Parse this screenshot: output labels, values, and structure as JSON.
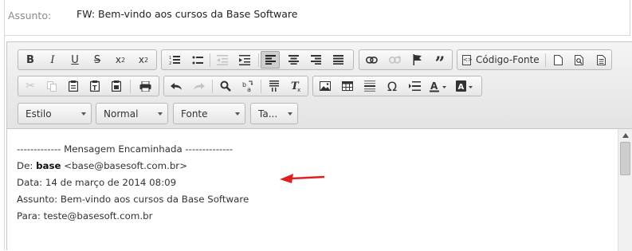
{
  "subject": {
    "label": "Assunto:",
    "value": "FW: Bem-vindo aos cursos da Base Software"
  },
  "toolbar": {
    "basicstyles": [
      {
        "name": "bold-button",
        "glyph": "B"
      },
      {
        "name": "italic-button",
        "glyph": "I"
      },
      {
        "name": "underline-button",
        "glyph": "U"
      },
      {
        "name": "strike-button",
        "glyph": "S"
      },
      {
        "name": "subscript-button",
        "glyph": "x₂"
      },
      {
        "name": "superscript-button",
        "glyph": "x²"
      }
    ],
    "source_label": "Código-Fonte",
    "style_dropdown": "Estilo",
    "format_dropdown": "Normal",
    "font_dropdown": "Fonte",
    "size_dropdown": "Ta..."
  },
  "message": {
    "separator": "------------- Mensagem Encaminhada --------------",
    "from_label": "De:",
    "from_name": "base",
    "from_email": "<base@basesoft.com.br>",
    "date": "Data: 14 de março de 2014 08:09",
    "subject": "Assunto: Bem-vindo aos cursos da Base Software",
    "to": "Para: teste@basesoft.com.br"
  },
  "colors": {
    "arrow": "#e02020",
    "border": "#c6c6c6"
  }
}
